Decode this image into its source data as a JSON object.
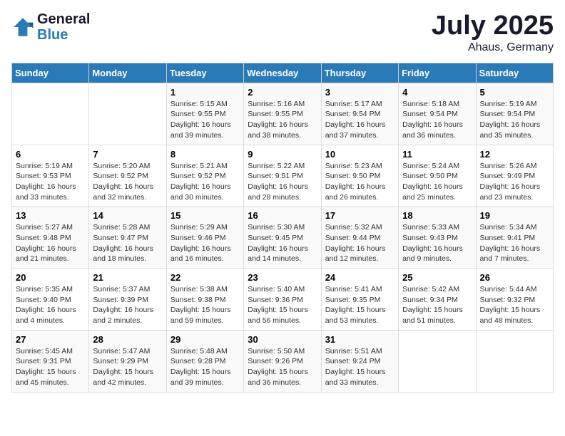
{
  "logo": {
    "line1": "General",
    "line2": "Blue"
  },
  "title": "July 2025",
  "subtitle": "Ahaus, Germany",
  "header_days": [
    "Sunday",
    "Monday",
    "Tuesday",
    "Wednesday",
    "Thursday",
    "Friday",
    "Saturday"
  ],
  "weeks": [
    [
      {
        "day": "",
        "info": ""
      },
      {
        "day": "",
        "info": ""
      },
      {
        "day": "1",
        "info": "Sunrise: 5:15 AM\nSunset: 9:55 PM\nDaylight: 16 hours\nand 39 minutes."
      },
      {
        "day": "2",
        "info": "Sunrise: 5:16 AM\nSunset: 9:55 PM\nDaylight: 16 hours\nand 38 minutes."
      },
      {
        "day": "3",
        "info": "Sunrise: 5:17 AM\nSunset: 9:54 PM\nDaylight: 16 hours\nand 37 minutes."
      },
      {
        "day": "4",
        "info": "Sunrise: 5:18 AM\nSunset: 9:54 PM\nDaylight: 16 hours\nand 36 minutes."
      },
      {
        "day": "5",
        "info": "Sunrise: 5:19 AM\nSunset: 9:54 PM\nDaylight: 16 hours\nand 35 minutes."
      }
    ],
    [
      {
        "day": "6",
        "info": "Sunrise: 5:19 AM\nSunset: 9:53 PM\nDaylight: 16 hours\nand 33 minutes."
      },
      {
        "day": "7",
        "info": "Sunrise: 5:20 AM\nSunset: 9:52 PM\nDaylight: 16 hours\nand 32 minutes."
      },
      {
        "day": "8",
        "info": "Sunrise: 5:21 AM\nSunset: 9:52 PM\nDaylight: 16 hours\nand 30 minutes."
      },
      {
        "day": "9",
        "info": "Sunrise: 5:22 AM\nSunset: 9:51 PM\nDaylight: 16 hours\nand 28 minutes."
      },
      {
        "day": "10",
        "info": "Sunrise: 5:23 AM\nSunset: 9:50 PM\nDaylight: 16 hours\nand 26 minutes."
      },
      {
        "day": "11",
        "info": "Sunrise: 5:24 AM\nSunset: 9:50 PM\nDaylight: 16 hours\nand 25 minutes."
      },
      {
        "day": "12",
        "info": "Sunrise: 5:26 AM\nSunset: 9:49 PM\nDaylight: 16 hours\nand 23 minutes."
      }
    ],
    [
      {
        "day": "13",
        "info": "Sunrise: 5:27 AM\nSunset: 9:48 PM\nDaylight: 16 hours\nand 21 minutes."
      },
      {
        "day": "14",
        "info": "Sunrise: 5:28 AM\nSunset: 9:47 PM\nDaylight: 16 hours\nand 18 minutes."
      },
      {
        "day": "15",
        "info": "Sunrise: 5:29 AM\nSunset: 9:46 PM\nDaylight: 16 hours\nand 16 minutes."
      },
      {
        "day": "16",
        "info": "Sunrise: 5:30 AM\nSunset: 9:45 PM\nDaylight: 16 hours\nand 14 minutes."
      },
      {
        "day": "17",
        "info": "Sunrise: 5:32 AM\nSunset: 9:44 PM\nDaylight: 16 hours\nand 12 minutes."
      },
      {
        "day": "18",
        "info": "Sunrise: 5:33 AM\nSunset: 9:43 PM\nDaylight: 16 hours\nand 9 minutes."
      },
      {
        "day": "19",
        "info": "Sunrise: 5:34 AM\nSunset: 9:41 PM\nDaylight: 16 hours\nand 7 minutes."
      }
    ],
    [
      {
        "day": "20",
        "info": "Sunrise: 5:35 AM\nSunset: 9:40 PM\nDaylight: 16 hours\nand 4 minutes."
      },
      {
        "day": "21",
        "info": "Sunrise: 5:37 AM\nSunset: 9:39 PM\nDaylight: 16 hours\nand 2 minutes."
      },
      {
        "day": "22",
        "info": "Sunrise: 5:38 AM\nSunset: 9:38 PM\nDaylight: 15 hours\nand 59 minutes."
      },
      {
        "day": "23",
        "info": "Sunrise: 5:40 AM\nSunset: 9:36 PM\nDaylight: 15 hours\nand 56 minutes."
      },
      {
        "day": "24",
        "info": "Sunrise: 5:41 AM\nSunset: 9:35 PM\nDaylight: 15 hours\nand 53 minutes."
      },
      {
        "day": "25",
        "info": "Sunrise: 5:42 AM\nSunset: 9:34 PM\nDaylight: 15 hours\nand 51 minutes."
      },
      {
        "day": "26",
        "info": "Sunrise: 5:44 AM\nSunset: 9:32 PM\nDaylight: 15 hours\nand 48 minutes."
      }
    ],
    [
      {
        "day": "27",
        "info": "Sunrise: 5:45 AM\nSunset: 9:31 PM\nDaylight: 15 hours\nand 45 minutes."
      },
      {
        "day": "28",
        "info": "Sunrise: 5:47 AM\nSunset: 9:29 PM\nDaylight: 15 hours\nand 42 minutes."
      },
      {
        "day": "29",
        "info": "Sunrise: 5:48 AM\nSunset: 9:28 PM\nDaylight: 15 hours\nand 39 minutes."
      },
      {
        "day": "30",
        "info": "Sunrise: 5:50 AM\nSunset: 9:26 PM\nDaylight: 15 hours\nand 36 minutes."
      },
      {
        "day": "31",
        "info": "Sunrise: 5:51 AM\nSunset: 9:24 PM\nDaylight: 15 hours\nand 33 minutes."
      },
      {
        "day": "",
        "info": ""
      },
      {
        "day": "",
        "info": ""
      }
    ]
  ]
}
